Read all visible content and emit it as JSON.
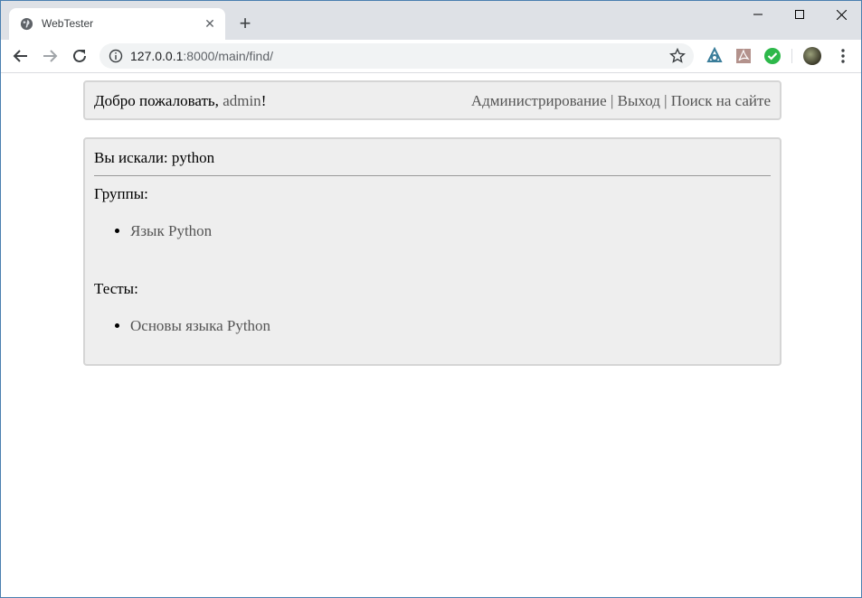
{
  "browser": {
    "tab_title": "WebTester",
    "tab_close": "✕",
    "new_tab": "+",
    "url_host": "127.0.0.1",
    "url_rest": ":8000/main/find/",
    "icons": [
      "globe-icon",
      "close-icon",
      "plus-icon",
      "back-icon",
      "forward-icon",
      "reload-icon",
      "info-icon",
      "star-icon",
      "extension-icon",
      "pdf-icon",
      "check-icon",
      "avatar",
      "menu-icon"
    ]
  },
  "header": {
    "welcome_prefix": "Добро пожаловать, ",
    "username": "admin",
    "welcome_suffix": "!",
    "links": [
      "Администрирование",
      "Выход",
      "Поиск на сайте"
    ],
    "separator": " | "
  },
  "search": {
    "query_label": "Вы искали: python",
    "groups_label": "Группы:",
    "groups": [
      "Язык Python"
    ],
    "tests_label": "Тесты:",
    "tests": [
      "Основы языка Python"
    ]
  },
  "colors": {
    "link": "#555555",
    "box_bg": "#eeeeee",
    "box_border": "#d5d5d5"
  }
}
